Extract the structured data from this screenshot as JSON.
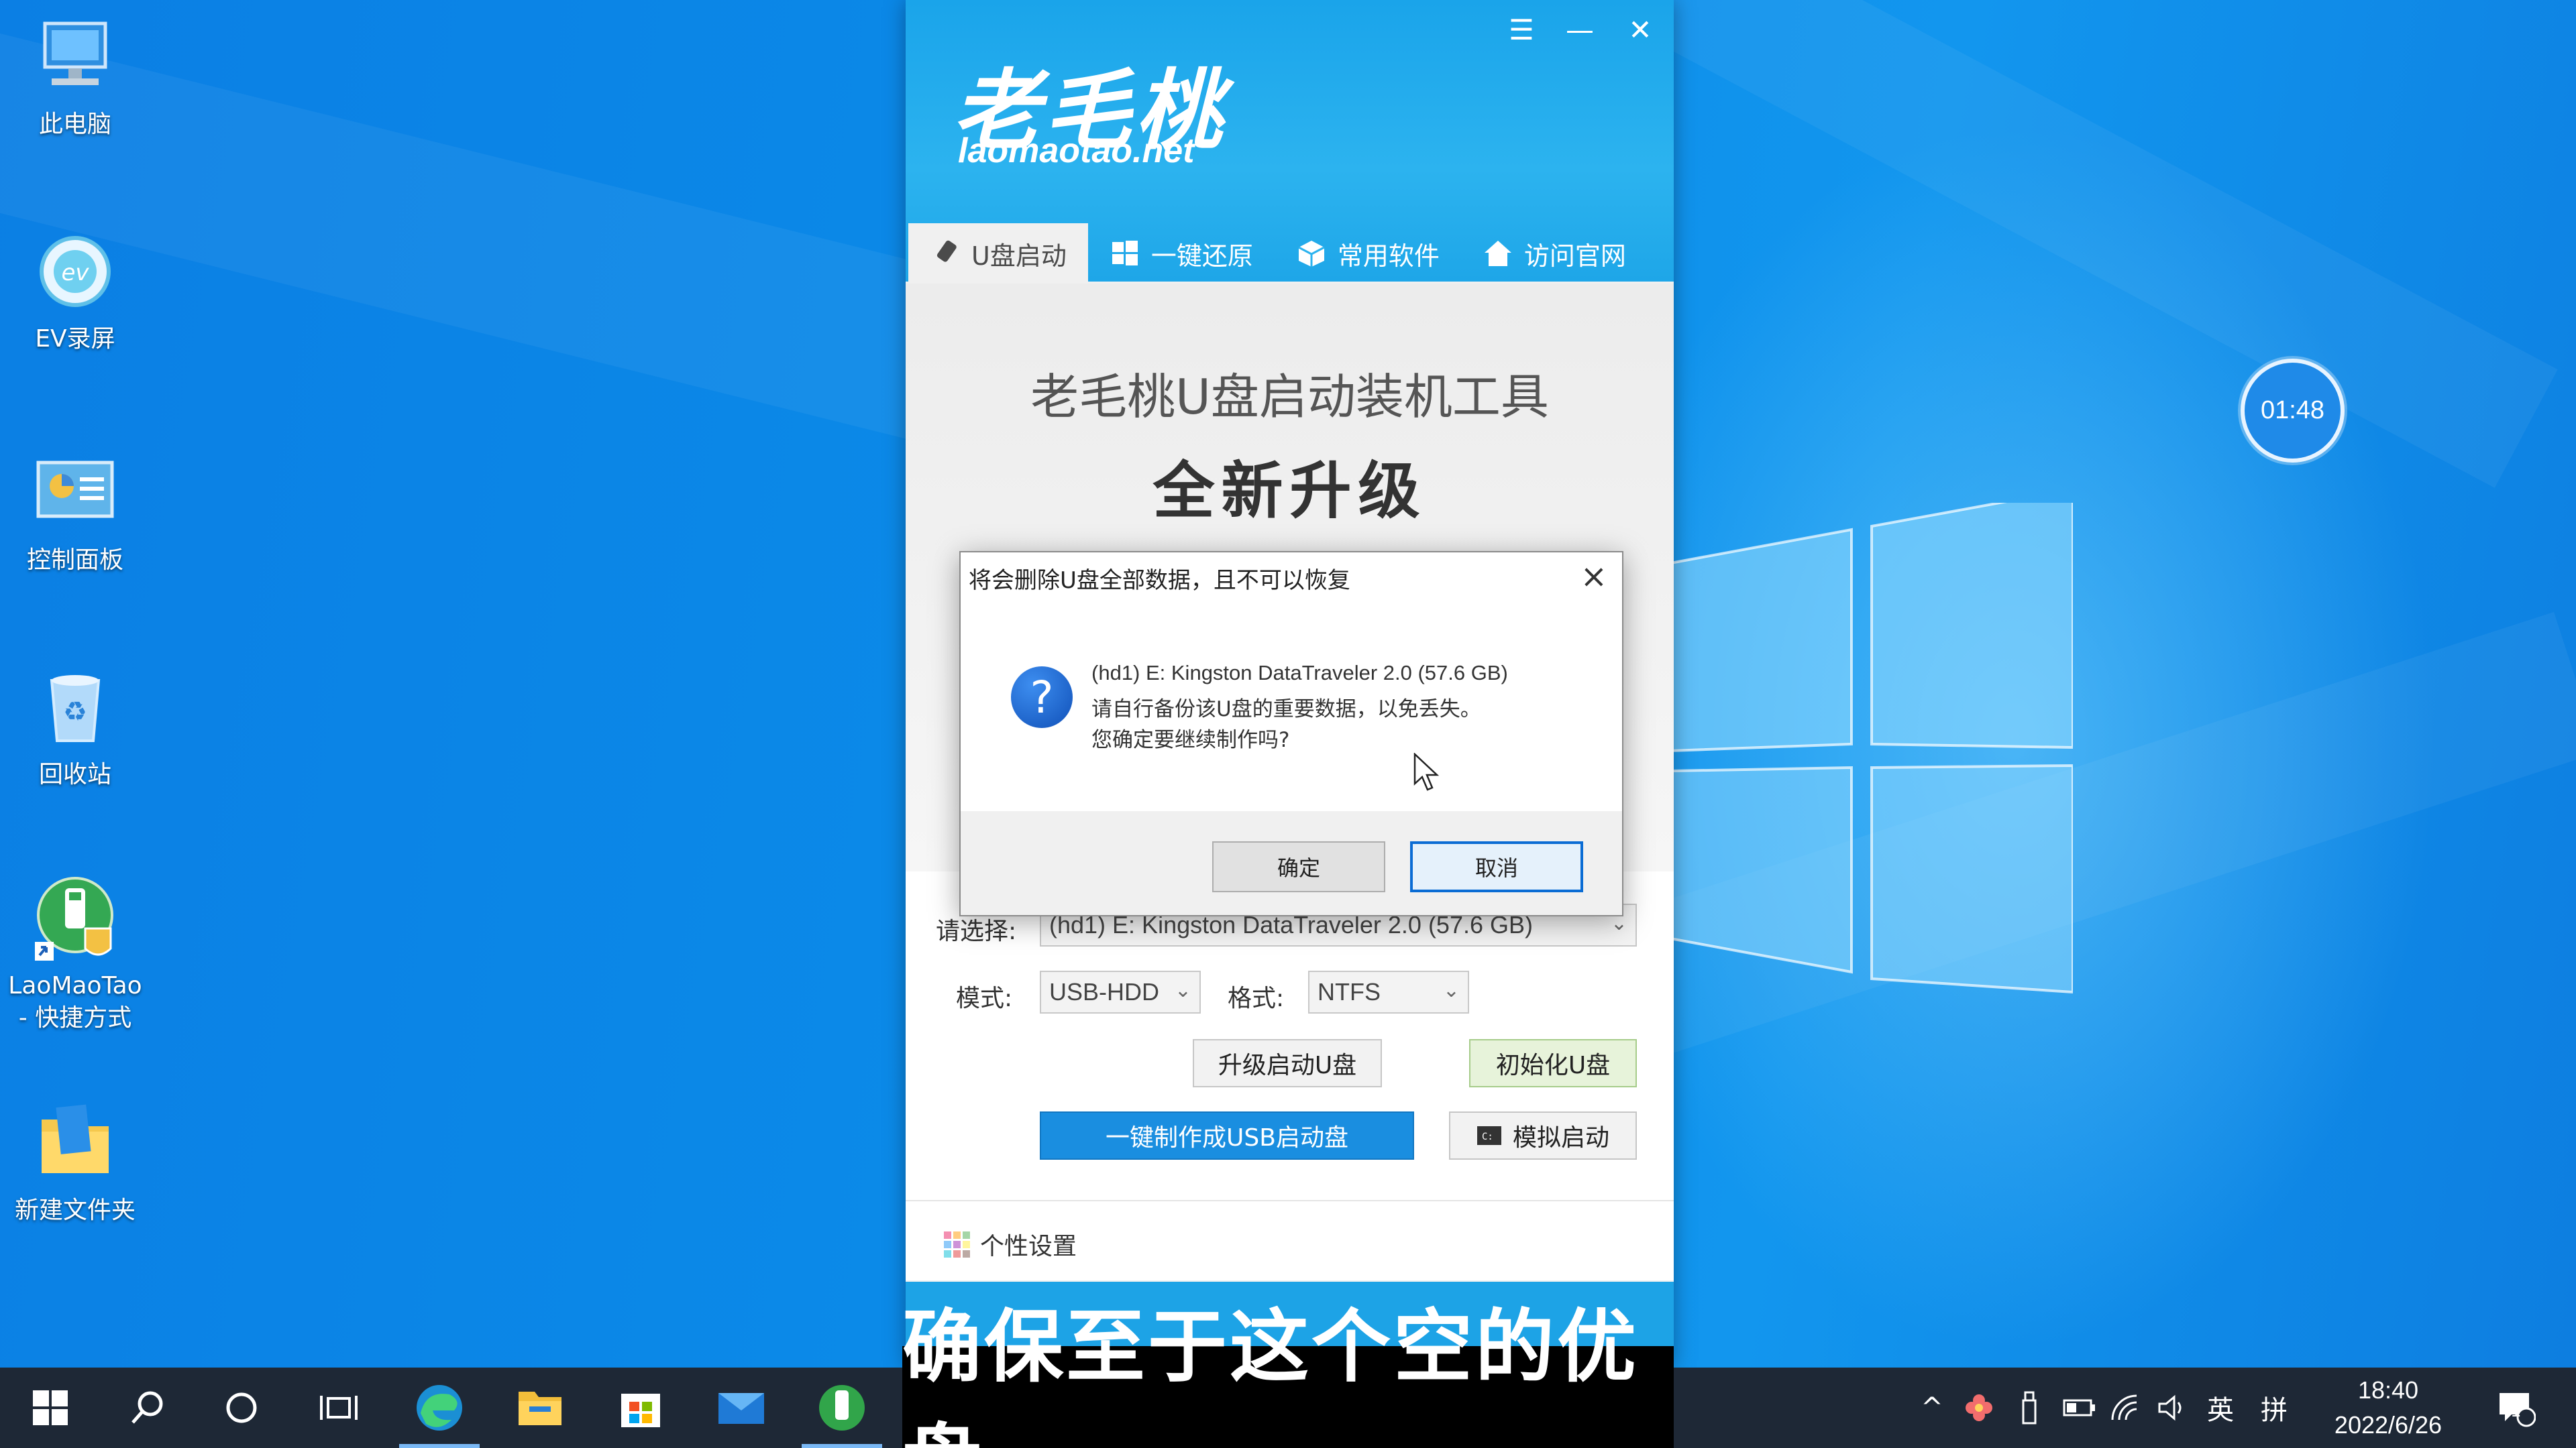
{
  "desktop": {
    "icons": [
      {
        "label": "此电脑",
        "icon": "computer-icon"
      },
      {
        "label": "EV录屏",
        "icon": "ev-recorder-icon"
      },
      {
        "label": "控制面板",
        "icon": "control-panel-icon"
      },
      {
        "label": "回收站",
        "icon": "recycle-bin-icon"
      },
      {
        "label": "LaoMaoTao\n- 快捷方式",
        "icon": "laomaotao-shortcut-icon"
      },
      {
        "label": "新建文件夹",
        "icon": "folder-icon"
      }
    ],
    "timer": "01:48"
  },
  "app": {
    "logo_cn": "老毛桃",
    "logo_en": "laomaotao.net",
    "window_controls": [
      "☰",
      "—",
      "✕"
    ],
    "tabs": [
      {
        "label": "U盘启动",
        "icon": "usb-drive-icon",
        "active": true
      },
      {
        "label": "一键还原",
        "icon": "windows-icon",
        "active": false
      },
      {
        "label": "常用软件",
        "icon": "box-icon",
        "active": false
      },
      {
        "label": "访问官网",
        "icon": "home-icon",
        "active": false
      }
    ],
    "hero_title": "老毛桃U盘启动装机工具",
    "hero_subtitle": "全新升级",
    "form": {
      "select_label": "请选择:",
      "select_value": "(hd1) E: Kingston DataTraveler 2.0 (57.6 GB)",
      "mode_label": "模式:",
      "mode_value": "USB-HDD",
      "format_label": "格式:",
      "format_value": "NTFS",
      "upgrade_button": "升级启动U盘",
      "init_button": "初始化U盘",
      "make_button": "一键制作成USB启动盘",
      "simulate_button": "模拟启动"
    },
    "settings_label": "个性设置"
  },
  "dialog": {
    "title": "将会删除U盘全部数据，且不可以恢复",
    "line1": "(hd1) E: Kingston DataTraveler 2.0 (57.6 GB)",
    "line2": "请自行备份该U盘的重要数据，以免丢失。",
    "line3": "您确定要继续制作吗?",
    "ok_button": "确定",
    "cancel_button": "取消"
  },
  "caption": "确保至于这个空的优盘",
  "taskbar": {
    "tray_language": "英",
    "tray_ime": "拼",
    "time": "18:40",
    "date": "2022/6/26",
    "notification_count": "1"
  },
  "colors": {
    "desktop_blue": "#0b7fe4",
    "app_header": "#1aa4ea",
    "primary_button": "#1a8ee0",
    "taskbar": "#1e2836"
  }
}
